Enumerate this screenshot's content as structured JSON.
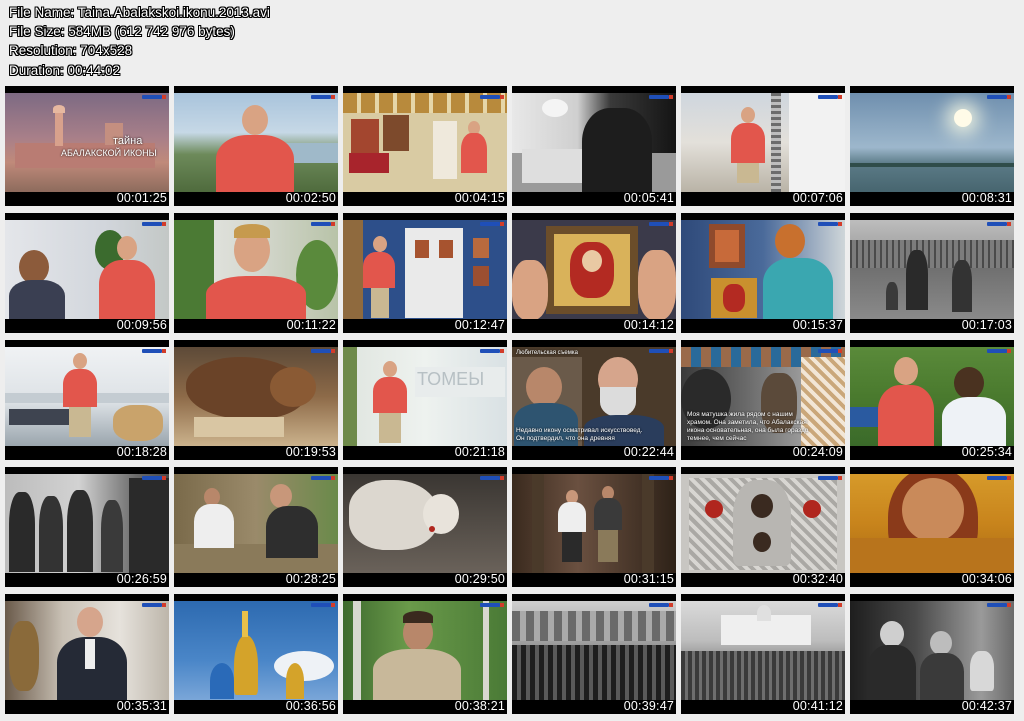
{
  "file_info": {
    "file_name": "File Name: Taina.Abalakskoi.ikonu.2013.avi",
    "file_size": "File Size: 584MB (612 742 976 bytes)",
    "resolution": "Resolution: 704x528",
    "duration": "Duration: 00:44:02"
  },
  "overlays": {
    "title_line1": "тайна",
    "title_line2": "АБАЛАКСКОЙ ИКОНЫ",
    "subtitle_row3_col4_head": "Любительская съемка",
    "subtitle_row3_col4": "Недавно икону осматривал искусствовед.\nОн подтвердил, что она древняя",
    "subtitle_row3_col5": "Моя матушка жила рядом с нашим\nхрамом. Она заметила, что Абалакская\nикона основательная, она была гораздо\nтемнее, чем сейчас"
  },
  "colors": {
    "background": "#eeeeee",
    "thumb_border": "#000000",
    "logo_blue": "#1f4fb8",
    "logo_red": "#d23c2a"
  },
  "thumbnails": [
    {
      "time": "00:01:25"
    },
    {
      "time": "00:02:50"
    },
    {
      "time": "00:04:15"
    },
    {
      "time": "00:05:41"
    },
    {
      "time": "00:07:06"
    },
    {
      "time": "00:08:31"
    },
    {
      "time": "00:09:56"
    },
    {
      "time": "00:11:22"
    },
    {
      "time": "00:12:47"
    },
    {
      "time": "00:14:12"
    },
    {
      "time": "00:15:37"
    },
    {
      "time": "00:17:03"
    },
    {
      "time": "00:18:28"
    },
    {
      "time": "00:19:53"
    },
    {
      "time": "00:21:18"
    },
    {
      "time": "00:22:44"
    },
    {
      "time": "00:24:09"
    },
    {
      "time": "00:25:34"
    },
    {
      "time": "00:26:59"
    },
    {
      "time": "00:28:25"
    },
    {
      "time": "00:29:50"
    },
    {
      "time": "00:31:15"
    },
    {
      "time": "00:32:40"
    },
    {
      "time": "00:34:06"
    },
    {
      "time": "00:35:31"
    },
    {
      "time": "00:36:56"
    },
    {
      "time": "00:38:21"
    },
    {
      "time": "00:39:47"
    },
    {
      "time": "00:41:12"
    },
    {
      "time": "00:42:37"
    }
  ]
}
